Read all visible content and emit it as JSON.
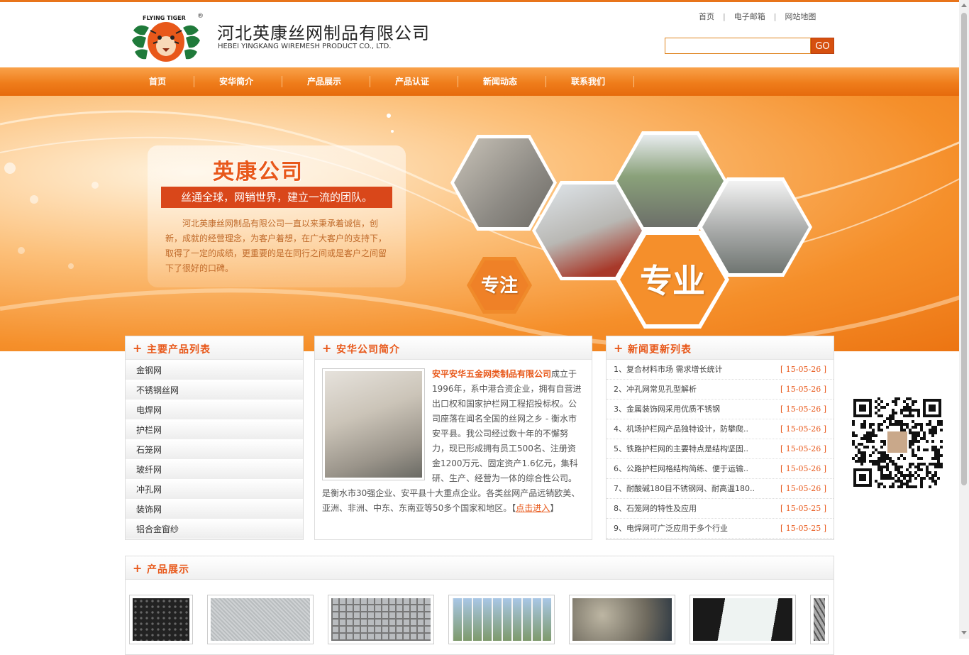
{
  "header": {
    "logo_brand": "FLYING TIGER",
    "company_cn": "河北英康丝网制品有限公司",
    "company_en": "HEBEI YINGKANG WIREMESH PRODUCT CO., LTD.",
    "top_links": [
      "首页",
      "电子邮箱",
      "网站地图"
    ],
    "search_placeholder": "",
    "search_button": "GO"
  },
  "nav": {
    "items": [
      "首页",
      "安华简介",
      "产品展示",
      "产品认证",
      "新闻动态",
      "联系我们"
    ]
  },
  "banner": {
    "title": "英康公司",
    "slogan": "丝通全球，网销世界，建立一流的团队。",
    "body": "河北英康丝网制品有限公司一直以来秉承着诚信，创新，成就的经营理念，为客户着想，在广大客户的支持下，取得了一定的成绩，更重要的是在同行之间或是客户之间留下了很好的口碑。",
    "hex_label_small": "专注",
    "hex_label_large": "专业"
  },
  "products_box": {
    "title": "主要产品列表",
    "items": [
      "金钢网",
      "不锈钢丝网",
      "电焊网",
      "护栏网",
      "石笼网",
      "玻纤网",
      "冲孔网",
      "装饰网",
      "铝合金窗纱"
    ]
  },
  "intro_box": {
    "title": "安华公司简介",
    "company": "安平安华五金网类制品有限公司",
    "text": "成立于1996年，系中港合资企业，拥有自营进出口权和国家护栏网工程招投标权。公司座落在闻名全国的丝网之乡 - 衡水市安平县。我公司经过数十年的不懈努力，现已形成拥有员工500名、注册资金1200万元、固定资产1.6亿元，集科研、生产、经营为一体的综合性公司。是衡水市30强企业、安平县十大重点企业。各类丝网产品远销欧美、亚洲、非洲、中东、东南亚等50多个国家和地区。",
    "more_open": "【",
    "more_label": "点击进入",
    "more_close": "】"
  },
  "news_box": {
    "title": "新闻更新列表",
    "items": [
      {
        "text": "1、复合材料市场 需求增长统计",
        "date": "[ 15-05-26 ]"
      },
      {
        "text": "2、冲孔网常见孔型解析",
        "date": "[ 15-05-26 ]"
      },
      {
        "text": "3、金属装饰网采用优质不锈钢",
        "date": "[ 15-05-26 ]"
      },
      {
        "text": "4、机场护栏网产品独特设计，防攀爬..",
        "date": "[ 15-05-26 ]"
      },
      {
        "text": "5、铁路护栏网的主要特点是结构坚固..",
        "date": "[ 15-05-26 ]"
      },
      {
        "text": "6、公路护栏网格结构简练、便于运输..",
        "date": "[ 15-05-26 ]"
      },
      {
        "text": "7、耐酸碱180目不锈钢网、耐高温180..",
        "date": "[ 15-05-26 ]"
      },
      {
        "text": "8、石笼网的特性及应用",
        "date": "[ 15-05-25 ]"
      },
      {
        "text": "9、电焊网可广泛应用于多个行业",
        "date": "[ 15-05-25 ]"
      }
    ]
  },
  "showcase": {
    "title": "产品展示",
    "thumb_names": [
      "perforated-mesh",
      "stainless-mesh",
      "welded-mesh",
      "fence-mesh",
      "gabion-mesh",
      "fiberglass-mesh",
      "expanded-mesh"
    ]
  },
  "colors": {
    "accent": "#e8581a",
    "nav_top": "#f9a24a",
    "nav_bottom": "#e66b0c"
  }
}
